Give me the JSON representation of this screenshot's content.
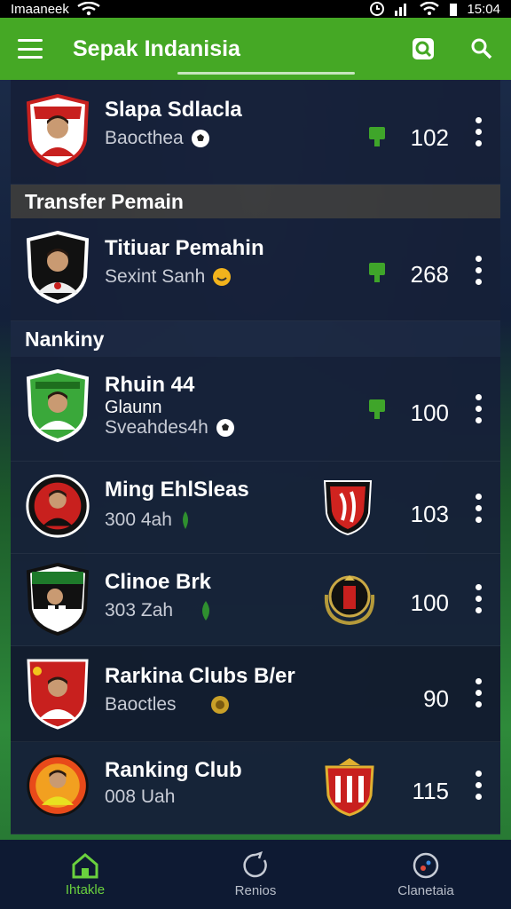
{
  "status_bar": {
    "carrier": "Imaaneek",
    "time": "15:04"
  },
  "app_bar": {
    "title": "Sepak Indanisia"
  },
  "cards": [
    {
      "name": "Slapa Sdlacla",
      "sub": "Baocthea",
      "score": "102"
    },
    {
      "name": "Titiuar Pemahin",
      "sub": "Sexint Sanh",
      "score": "268"
    },
    {
      "name": "Rhuin 44",
      "line2": "Glaunn",
      "sub": "Sveahdes4h",
      "score": "100"
    },
    {
      "name": "Ming EhlSleas",
      "sub": "300 4ah",
      "score": "103"
    },
    {
      "name": "Clinoe Brk",
      "sub": "303 Zah",
      "score": "100"
    },
    {
      "name": "Rarkina Clubs B/er",
      "sub": "Baoctles",
      "score": "90"
    },
    {
      "name": "Ranking Club",
      "sub": "008 Uah",
      "score": "115"
    }
  ],
  "sections": {
    "transfer": "Transfer Pemain",
    "ranking": "Nankiny"
  },
  "bottom_nav": [
    {
      "label": "Ihtakle",
      "active": true
    },
    {
      "label": "Renios",
      "active": false
    },
    {
      "label": "Clanetaia",
      "active": false
    }
  ],
  "colors": {
    "app_bar": "#45a825",
    "card": "#162038",
    "accent": "#6ad13e",
    "nav_bg": "#0e1a33"
  },
  "icons": {
    "menu": "menu-icon",
    "search_box": "search-square-icon",
    "search": "search-icon",
    "vote": "vote-flag-icon",
    "more": "more-vert-icon",
    "home": "home-icon",
    "results": "circle-refresh-icon",
    "community": "globe-icon",
    "ball": "soccer-ball-icon"
  }
}
